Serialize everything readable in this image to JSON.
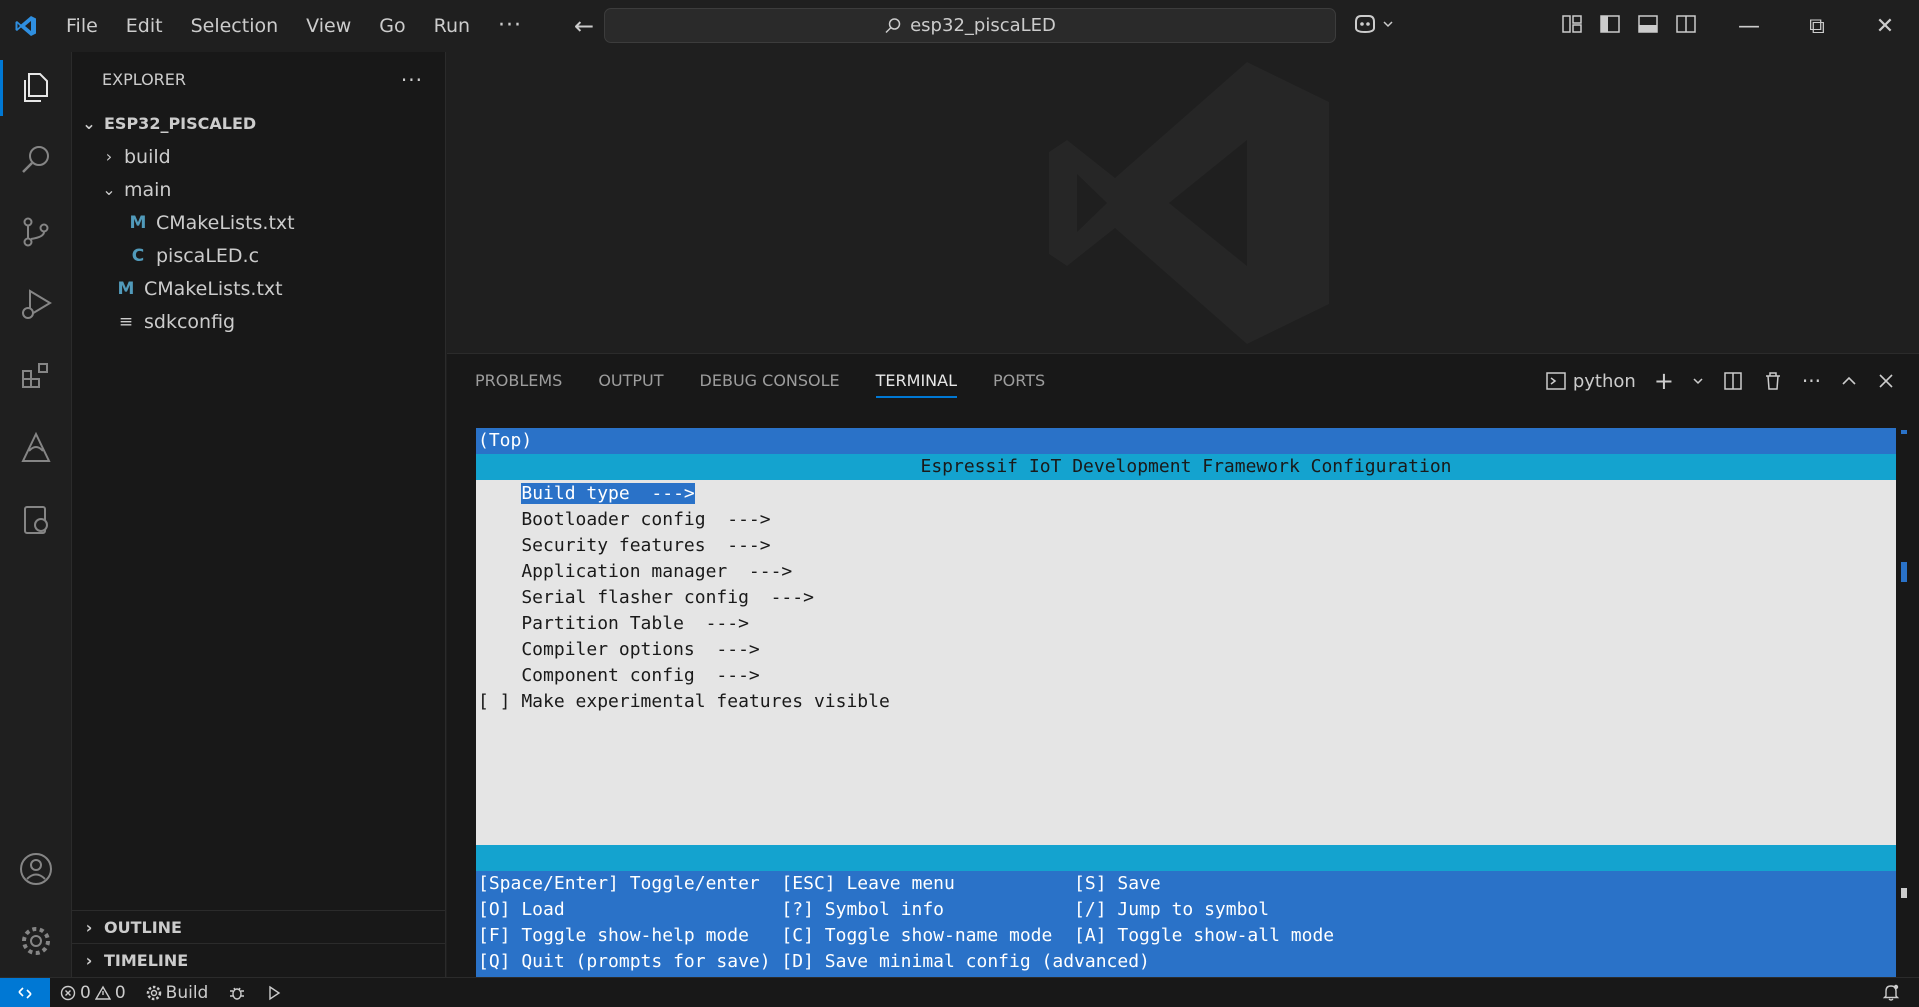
{
  "titlebar": {
    "menu": [
      "File",
      "Edit",
      "Selection",
      "View",
      "Go",
      "Run"
    ],
    "more": "···",
    "search_text": "esp32_piscaLED"
  },
  "explorer": {
    "title": "EXPLORER",
    "more": "···",
    "root": "ESP32_PISCALED",
    "items": [
      {
        "label": "build",
        "kind": "folder-collapsed",
        "depth": 1
      },
      {
        "label": "main",
        "kind": "folder-expanded",
        "depth": 1
      },
      {
        "label": "CMakeLists.txt",
        "kind": "file",
        "badge": "M",
        "depth": 2
      },
      {
        "label": "piscaLED.c",
        "kind": "file",
        "badge": "C",
        "depth": 2
      },
      {
        "label": "CMakeLists.txt",
        "kind": "file",
        "badge": "M",
        "depth": 1
      },
      {
        "label": "sdkconfig",
        "kind": "file",
        "badge": "≡",
        "depth": 1
      }
    ],
    "outline": "OUTLINE",
    "timeline": "TIMELINE"
  },
  "panel": {
    "tabs": [
      "PROBLEMS",
      "OUTPUT",
      "DEBUG CONSOLE",
      "TERMINAL",
      "PORTS"
    ],
    "active_tab": "TERMINAL",
    "terminal_name": "python"
  },
  "terminal": {
    "top": "(Top)",
    "title": "Espressif IoT Development Framework Configuration",
    "selected": "Build type  --->",
    "menu_lines": [
      "    Bootloader config  --->",
      "    Security features  --->",
      "    Application manager  --->",
      "    Serial flasher config  --->",
      "    Partition Table  --->",
      "    Compiler options  --->",
      "    Component config  --->",
      "[ ] Make experimental features visible"
    ],
    "help": [
      "[Space/Enter] Toggle/enter  [ESC] Leave menu           [S] Save",
      "[O] Load                    [?] Symbol info            [/] Jump to symbol",
      "[F] Toggle show-help mode   [C] Toggle show-name mode  [A] Toggle show-all mode",
      "[Q] Quit (prompts for save) [D] Save minimal config (advanced)"
    ]
  },
  "status": {
    "errors": "0",
    "warnings": "0",
    "build": "Build"
  },
  "colors": {
    "accent": "#0078d4",
    "menuconfig_blue": "#2a72c8",
    "menuconfig_cyan": "#14a3cf"
  }
}
